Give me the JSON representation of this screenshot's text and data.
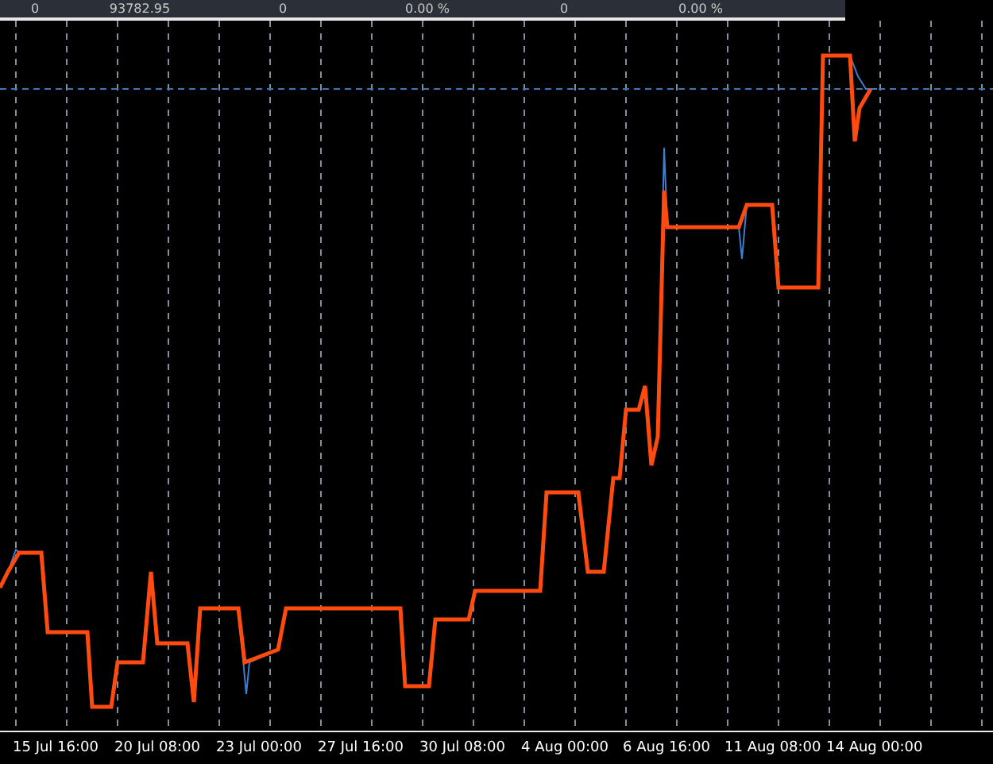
{
  "summary_row": [
    "0",
    "93782.95",
    "0",
    "0.00 %",
    "0",
    "0.00 %"
  ],
  "time_labels": [
    "15 Jul 16:00",
    "20 Jul 08:00",
    "23 Jul 00:00",
    "27 Jul 16:00",
    "30 Jul 08:00",
    "4 Aug 00:00",
    "6 Aug 16:00",
    "11 Aug 08:00",
    "14 Aug 00:00"
  ]
}
